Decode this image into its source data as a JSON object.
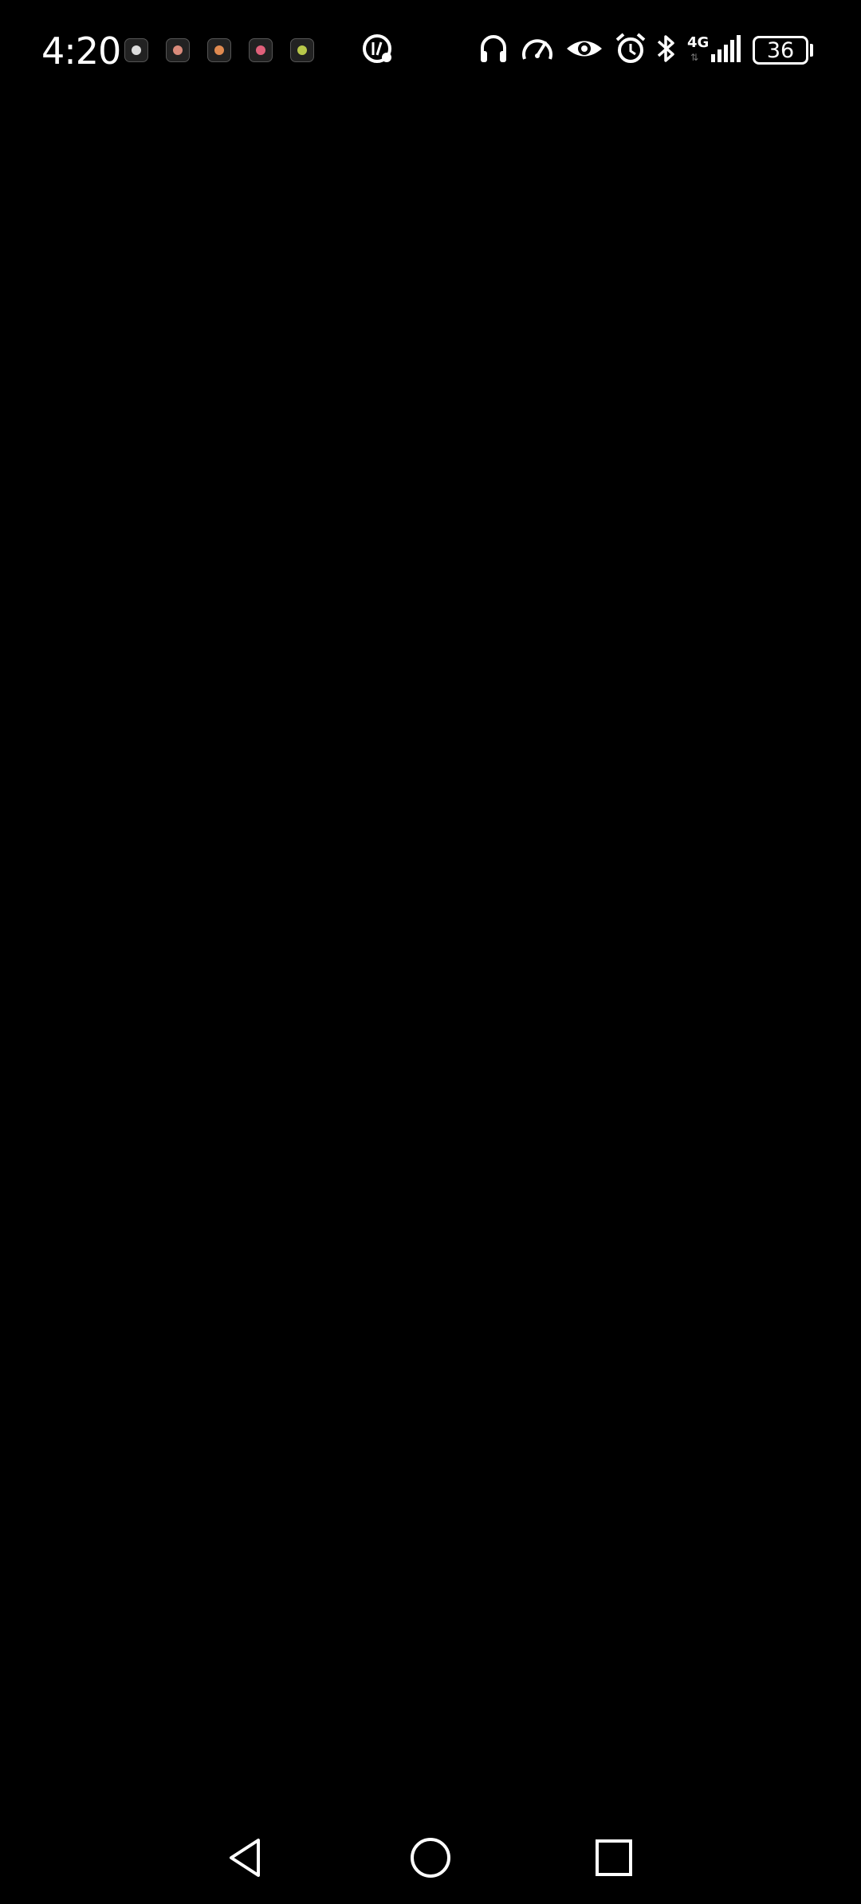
{
  "status_bar": {
    "time": "4:20",
    "network": "4G",
    "battery_level": "36",
    "notification_icons": [
      "app-icon-1",
      "app-icon-2",
      "app-icon-3",
      "app-icon-4",
      "app-icon-5"
    ],
    "system_icons": [
      "data-saver-icon",
      "headphones-icon",
      "speedometer-icon",
      "eye-icon",
      "alarm-icon",
      "bluetooth-icon",
      "signal-icon"
    ]
  },
  "colors": {
    "background": "#000000",
    "foreground": "#ffffff"
  },
  "navigation_bar": {
    "buttons": [
      "back-icon",
      "home-icon",
      "recents-icon"
    ]
  }
}
